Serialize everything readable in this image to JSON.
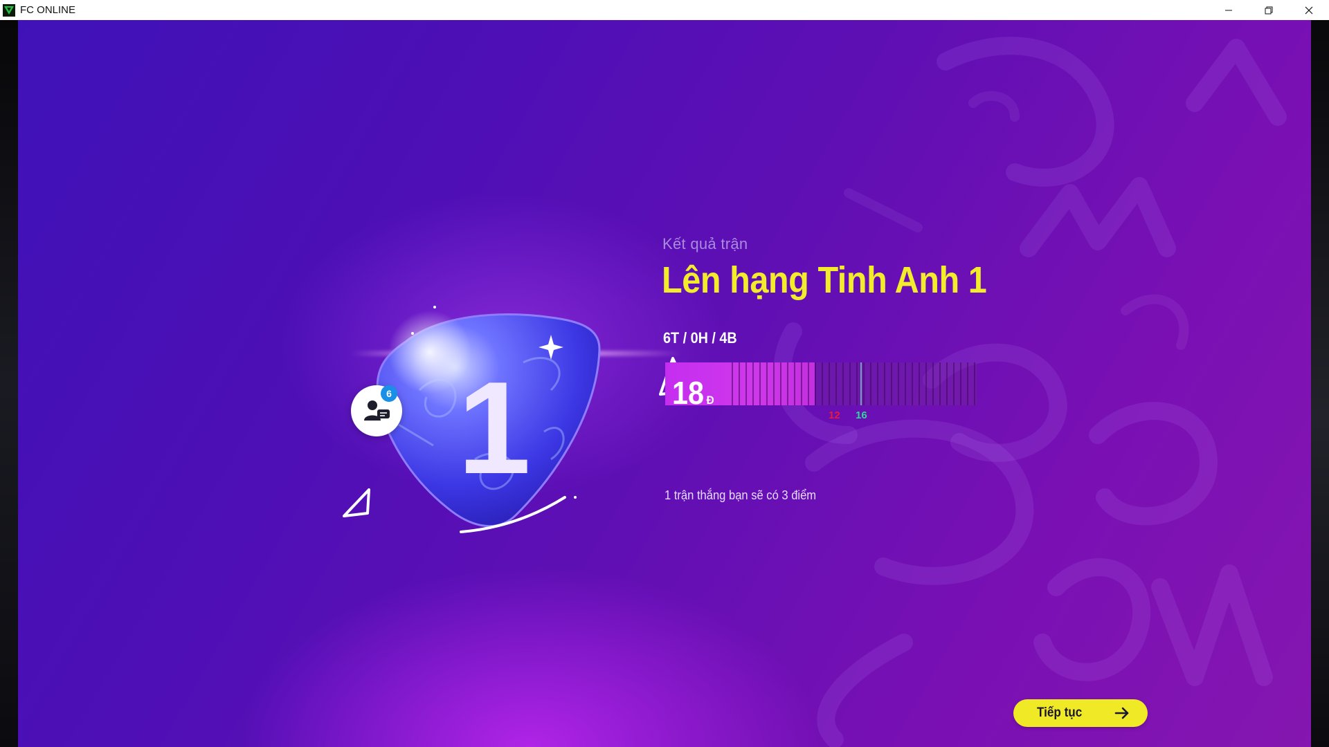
{
  "window": {
    "title": "FC ONLINE",
    "icons": {
      "app": "fc-online-logo-icon",
      "minimize": "minimize-icon",
      "restore": "restore-icon",
      "close": "close-icon"
    }
  },
  "badge": {
    "rank_numeral": "1"
  },
  "chat": {
    "unread_count": "6",
    "icon": "friends-chat-icon"
  },
  "result": {
    "label": "Kết quả trận",
    "title": "Lên hạng Tinh Anh 1",
    "record": "6T / 0H / 4B",
    "points_value": "18",
    "points_unit": "Đ",
    "progress_fraction": 0.48,
    "markers": [
      {
        "label": "12",
        "color": "#e8193a"
      },
      {
        "label": "16",
        "color": "#2fd89a"
      }
    ],
    "hint": "1 trận thắng bạn sẽ có 3 điểm"
  },
  "footer": {
    "continue_label": "Tiếp tục",
    "continue_icon": "arrow-right-icon"
  },
  "colors": {
    "accent_yellow": "#f2ec2c",
    "background_purple": "#5f0fb4",
    "progress_fill": "#c52ef0"
  }
}
